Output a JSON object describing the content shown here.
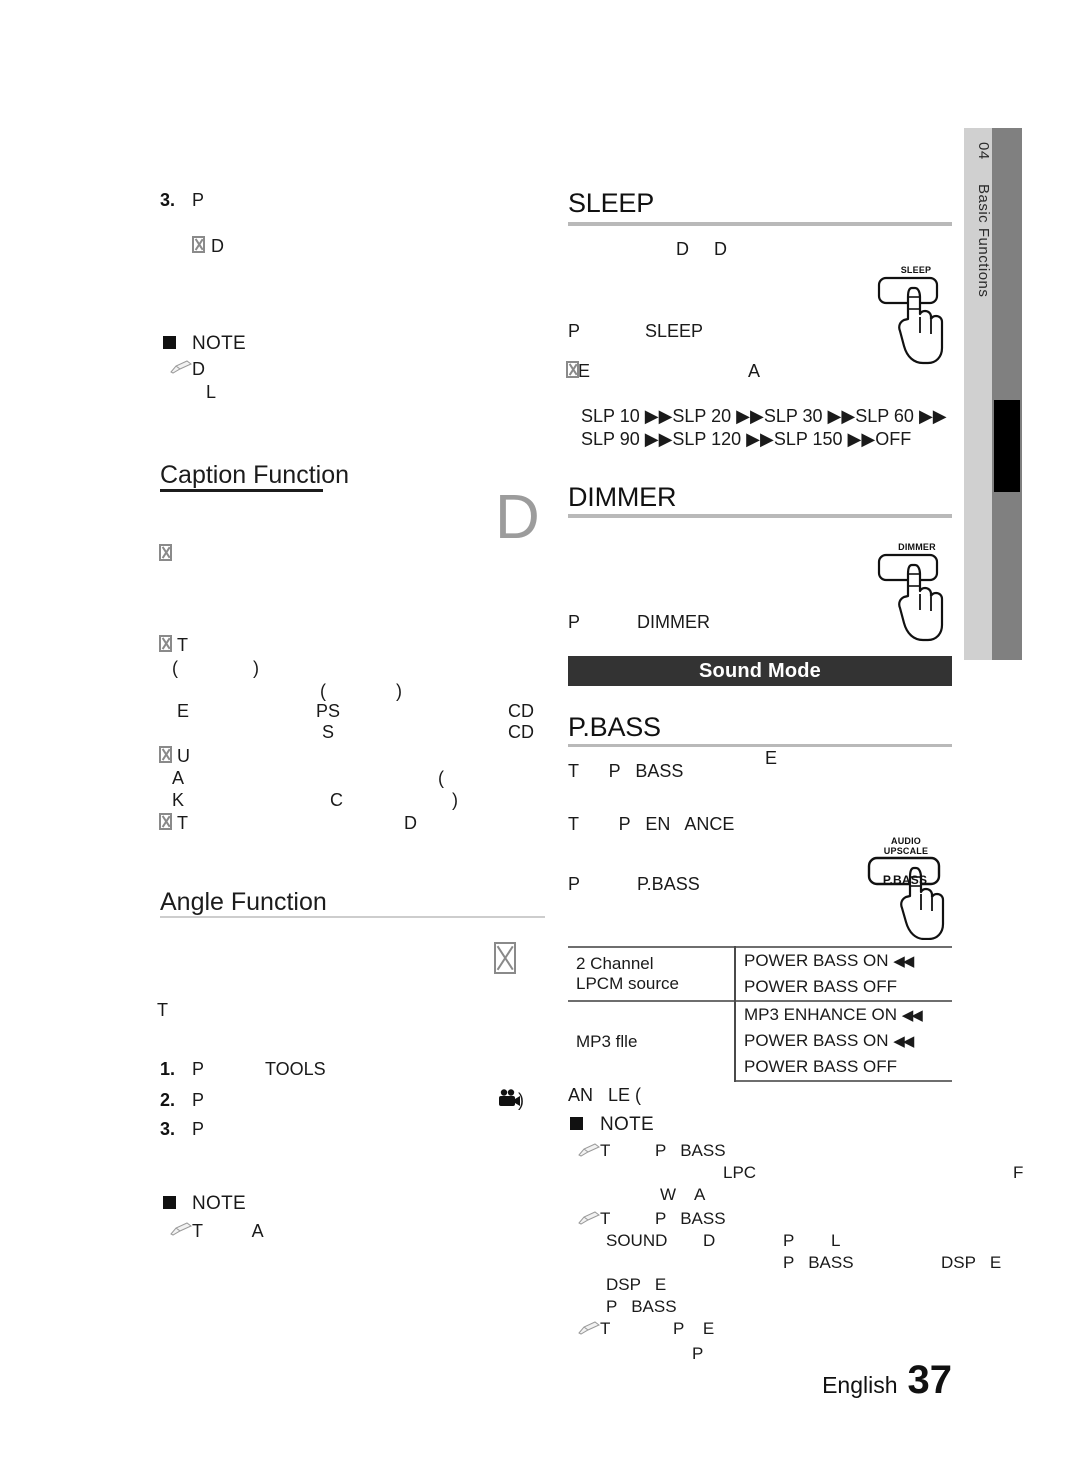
{
  "page": {
    "language": "English",
    "number": "37",
    "chapter_number": "04",
    "chapter_title": "Basic Functions"
  },
  "left_column": {
    "step3": {
      "num": "3.",
      "text": "P"
    },
    "step3_sub": {
      "bullet": "tofu",
      "text": "D"
    },
    "note1": {
      "label": "NOTE",
      "lines": [
        "D",
        "L"
      ]
    },
    "caption_function": {
      "heading": "Caption Function",
      "disc_glyph": "D",
      "bullets": [
        {
          "bullet": "tofu",
          "text": ""
        },
        {
          "bullet": "tofu",
          "text": "T"
        }
      ],
      "lines": [
        {
          "text": "(               )"
        },
        {
          "text": "(              )"
        },
        {
          "text": "E"
        },
        {
          "text": "PS"
        },
        {
          "text": "CD"
        },
        {
          "text": "S"
        },
        {
          "text": "CD"
        },
        {
          "text": "U"
        },
        {
          "text": "A"
        },
        {
          "text": "("
        },
        {
          "text": "K"
        },
        {
          "text": "C"
        },
        {
          "text": ")"
        },
        {
          "text": "T"
        },
        {
          "text": "D"
        }
      ]
    },
    "angle_function": {
      "heading": "Angle Function",
      "tofu_icon": "tofu",
      "intro": "T",
      "steps": [
        {
          "num": "1.",
          "text": "P",
          "extra": "TOOLS"
        },
        {
          "num": "2.",
          "text": "P",
          "icon": "camera-icon",
          "suffix": ")"
        },
        {
          "num": "3.",
          "text": "P"
        }
      ],
      "note": {
        "label": "NOTE",
        "lines": [
          "T          A"
        ]
      }
    }
  },
  "right_column": {
    "sleep": {
      "heading": "SLEEP",
      "line1": "D     D",
      "line2_a": "P",
      "line2_b": "SLEEP",
      "line3_a": "E",
      "line3_b": "A",
      "sequence_line1": "SLP 10 ▶▶SLP 20 ▶▶SLP 30 ▶▶SLP 60 ▶▶",
      "sequence_line2": "SLP 90 ▶▶SLP 120 ▶▶SLP 150 ▶▶OFF",
      "button_caption": "SLEEP"
    },
    "dimmer": {
      "heading": "DIMMER",
      "line_a": "P",
      "line_b": "DIMMER",
      "button_caption": "DIMMER"
    },
    "sound_mode_banner": "Sound Mode",
    "pbass": {
      "heading": "P.BASS",
      "line1_e": "E",
      "line1": "T      P   BASS",
      "line2": "T        P   EN   ANCE",
      "line3_a": "P",
      "line3_b": "P.BASS",
      "button_caption_top": "AUDIO\nUPSCALE",
      "button_caption_main": "P.BASS",
      "table": {
        "rows": [
          {
            "label_lines": [
              "2 Channel",
              "LPCM source"
            ],
            "values": [
              {
                "text": "POWER BASS ON",
                "marker": "◀◀"
              },
              {
                "text": "POWER BASS OFF",
                "marker": ""
              }
            ]
          },
          {
            "label_lines": [
              "MP3 flle"
            ],
            "values": [
              {
                "text": "MP3 ENHANCE ON",
                "marker": "◀◀"
              },
              {
                "text": "POWER BASS ON",
                "marker": "◀◀"
              },
              {
                "text": "POWER BASS OFF",
                "marker": ""
              }
            ]
          }
        ]
      },
      "after_table": "AN   LE (",
      "note": {
        "label": "NOTE",
        "items": [
          {
            "frag": [
              "T",
              "P   BASS"
            ]
          },
          {
            "frag": [
              "LPC",
              "F"
            ]
          },
          {
            "frag": [
              "W    A"
            ]
          },
          {
            "frag": [
              "T",
              "P   BASS"
            ]
          },
          {
            "frag": [
              "SOUND",
              "D",
              "P",
              "L"
            ]
          },
          {
            "frag": [
              "P   BASS",
              "DSP   E"
            ]
          },
          {
            "frag": [
              "DSP   E"
            ]
          },
          {
            "frag": [
              "P   BASS"
            ]
          },
          {
            "frag": [
              "T",
              "P    E"
            ]
          },
          {
            "frag": [
              "P"
            ]
          }
        ]
      }
    }
  },
  "colors": {
    "banner_bg": "#333333",
    "rule_gray": "#b9b9b9",
    "tab_light": "#d0d0d0",
    "tab_dark": "#808080",
    "tab_black": "#000000"
  }
}
